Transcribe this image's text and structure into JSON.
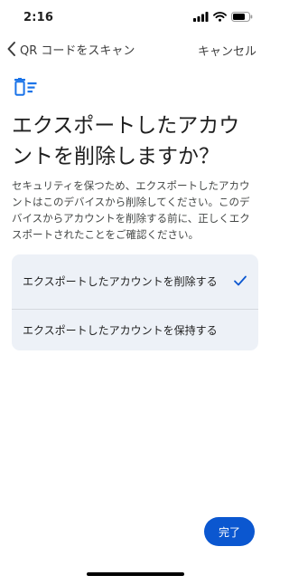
{
  "status_bar": {
    "time": "2:16"
  },
  "nav": {
    "back_label": "QR コードをスキャン",
    "cancel_label": "キャンセル"
  },
  "page": {
    "icon": "delete-list-icon",
    "title": "エクスポートしたアカウントを削除しますか？",
    "description": "セキュリティを保つため、エクスポートしたアカウントはこのデバイスから削除してください。このデバイスからアカウントを削除する前に、正しくエクスポートされたことをご確認ください。"
  },
  "options": [
    {
      "label": "エクスポートしたアカウントを削除する",
      "selected": true
    },
    {
      "label": "エクスポートしたアカウントを保持する",
      "selected": false
    }
  ],
  "done_label": "完了",
  "colors": {
    "accent": "#0b57d0",
    "option_bg": "#edf1f7"
  }
}
